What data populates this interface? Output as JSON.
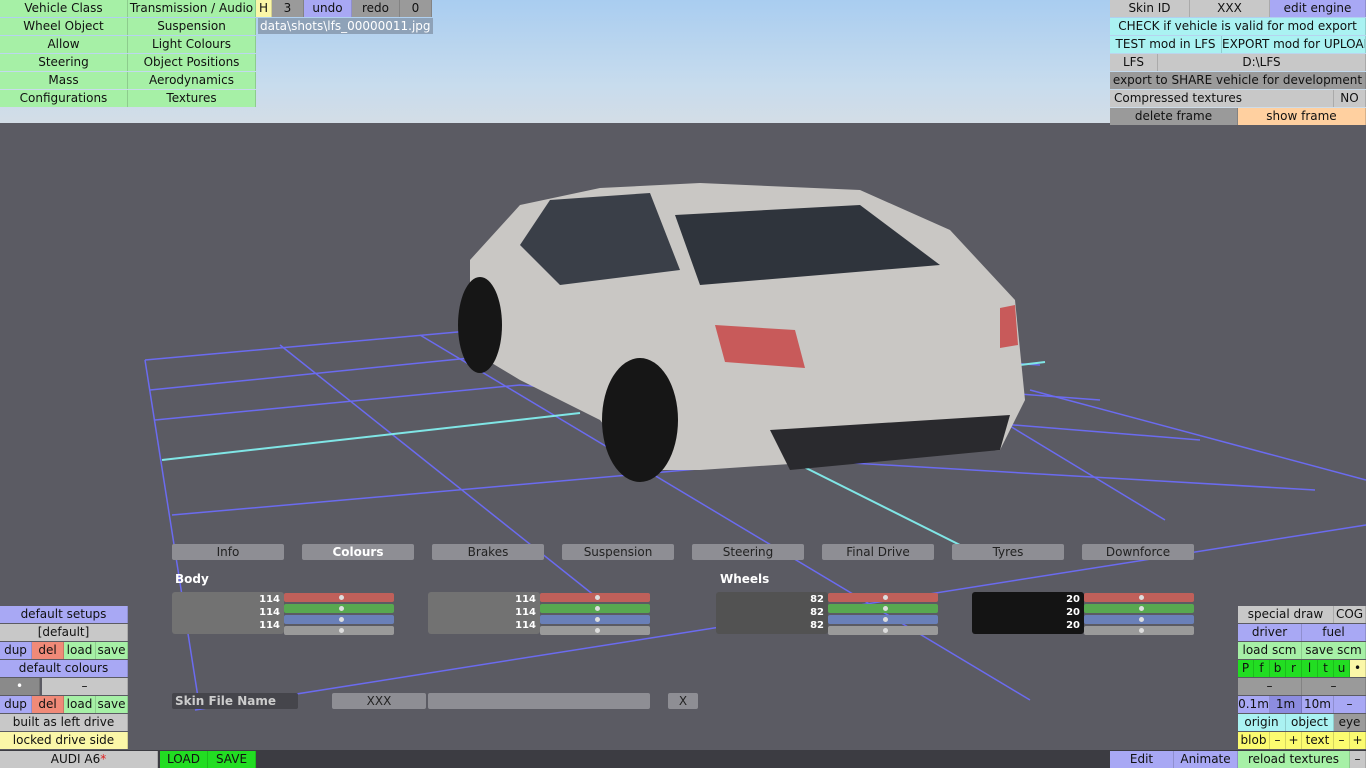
{
  "top_menu": {
    "col1": [
      "Vehicle Class",
      "Wheel Object",
      "Allow",
      "Steering",
      "Mass",
      "Configurations"
    ],
    "col2": [
      "Transmission / Audio",
      "Suspension",
      "Light Colours",
      "Object Positions",
      "Aerodynamics",
      "Textures"
    ],
    "h": "H",
    "num": "3",
    "undo": "undo",
    "redo": "redo",
    "counter": "0",
    "screenshot_path": "data\\shots\\lfs_00000011.jpg"
  },
  "top_right": {
    "skin_id": "Skin ID",
    "skin_value": "XXX",
    "edit_engine": "edit engine",
    "check": "CHECK if vehicle is valid for mod export",
    "test": "TEST mod in LFS",
    "export": "EXPORT mod for UPLOAD",
    "lfs": "LFS",
    "lfs_path": "D:\\LFS",
    "share": "export to SHARE vehicle for development",
    "compressed": "Compressed textures",
    "compressed_value": "NO",
    "delete_frame": "delete frame",
    "show_frame": "show frame"
  },
  "tabs": [
    "Info",
    "Colours",
    "Brakes",
    "Suspension",
    "Steering",
    "Final Drive",
    "Tyres",
    "Downforce"
  ],
  "colours": {
    "body_label": "Body",
    "wheels_label": "Wheels",
    "swatches": [
      {
        "values": [
          "114",
          "114",
          "114"
        ],
        "color": "#727272"
      },
      {
        "values": [
          "114",
          "114",
          "114"
        ],
        "color": "#727272"
      },
      {
        "values": [
          "82",
          "82",
          "82"
        ],
        "color": "#525252"
      },
      {
        "values": [
          "20",
          "20",
          "20"
        ],
        "color": "#141414"
      }
    ],
    "skin_file_label": "Skin File Name",
    "skin_file_value": "XXX",
    "clear": "X"
  },
  "left_panel": {
    "default_setups": "default setups",
    "setup_value": "[default]",
    "dup": "dup",
    "del": "del",
    "load": "load",
    "save": "save",
    "default_colours": "default colours",
    "dot": "•",
    "dash": "–",
    "left_drive": "built as left drive",
    "locked": "locked drive side"
  },
  "bottom": {
    "car_name": "AUDI A6",
    "modified": "*",
    "load": "LOAD",
    "save": "SAVE",
    "edit": "Edit",
    "animate": "Animate",
    "reload": "reload textures",
    "dash": "–"
  },
  "right_panel": {
    "special_draw": "special draw",
    "cog": "COG",
    "driver": "driver",
    "fuel": "fuel",
    "load_scm": "load scm",
    "save_scm": "save scm",
    "toggles": [
      "P",
      "f",
      "b",
      "r",
      "l",
      "t",
      "u",
      "•"
    ],
    "dash": "–",
    "scales": [
      "0.1m",
      "1m",
      "10m",
      "–"
    ],
    "origin": "origin",
    "object": "object",
    "eye": "eye",
    "blob": "blob",
    "minus": "–",
    "plus": "+",
    "text": "text"
  }
}
